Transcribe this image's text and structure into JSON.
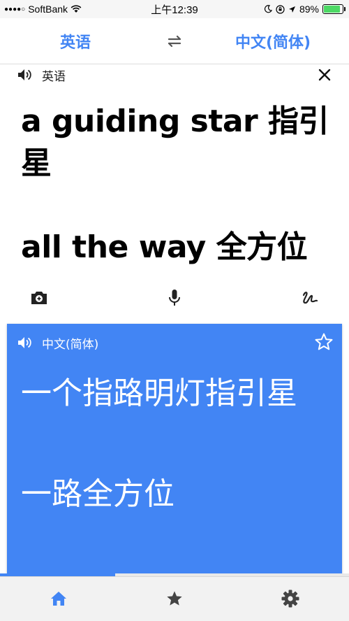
{
  "status_bar": {
    "signal": "●●●●○",
    "carrier": "SoftBank",
    "time": "上午12:39",
    "battery_percent": "89%",
    "battery_level": 0.89
  },
  "lang_bar": {
    "source": "英语",
    "target": "中文(简体)"
  },
  "input": {
    "language": "英语",
    "lines": [
      "a guiding star 指引星",
      "",
      "all the way 全方位"
    ]
  },
  "output": {
    "language": "中文(简体)",
    "lines": [
      "一个指路明灯指引星",
      "",
      "一路全方位"
    ]
  },
  "progress": {
    "fraction": 0.33
  },
  "colors": {
    "accent": "#4285f4",
    "battery": "#4cd964"
  },
  "icons": {
    "swap": "swap-arrows-icon",
    "speaker": "speaker-icon",
    "close": "close-icon",
    "camera": "camera-icon",
    "mic": "microphone-icon",
    "handwriting": "handwriting-icon",
    "star": "star-outline-icon",
    "home": "home-icon",
    "saved": "star-icon",
    "settings": "gear-icon"
  }
}
